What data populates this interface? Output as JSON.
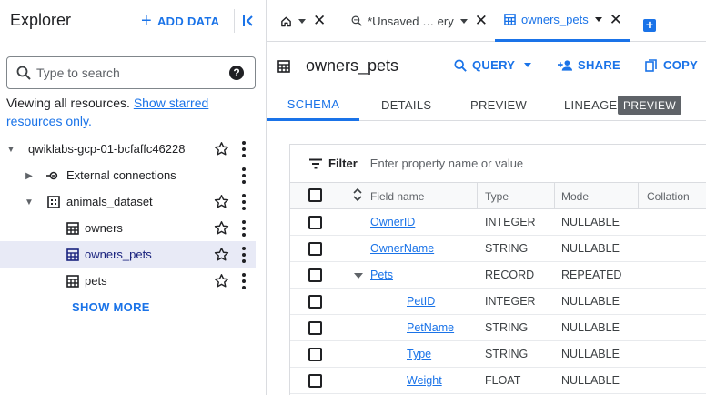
{
  "explorer": {
    "title": "Explorer",
    "add_data_label": "ADD DATA",
    "search_placeholder": "Type to search",
    "viewing_text": "Viewing all resources.",
    "show_starred_link": "Show starred resources only.",
    "tree": [
      {
        "label": "qwiklabs-gcp-01-bcfaffc46228",
        "level": 0,
        "icon": "none",
        "expanded": true,
        "starred": false
      },
      {
        "label": "External connections",
        "level": 1,
        "icon": "connection-icon",
        "expanded": false
      },
      {
        "label": "animals_dataset",
        "level": 1,
        "icon": "dataset-icon",
        "expanded": true
      },
      {
        "label": "owners",
        "level": 2,
        "icon": "table-icon"
      },
      {
        "label": "owners_pets",
        "level": 2,
        "icon": "table-icon",
        "selected": true
      },
      {
        "label": "pets",
        "level": 2,
        "icon": "table-icon"
      }
    ],
    "show_more_label": "SHOW MORE"
  },
  "tabs": {
    "items": [
      {
        "label": "",
        "icon": "home-icon"
      },
      {
        "label": "*Unsaved … ery",
        "icon": "query-icon"
      },
      {
        "label": "owners_pets",
        "icon": "table-icon",
        "active": true
      }
    ]
  },
  "table_header": {
    "name": "owners_pets",
    "query_label": "QUERY",
    "share_label": "SHARE",
    "copy_label": "COPY"
  },
  "subtabs": {
    "schema": "SCHEMA",
    "details": "DETAILS",
    "preview": "PREVIEW",
    "lineage": "LINEAGE",
    "lineage_badge": "PREVIEW"
  },
  "schema": {
    "filter_label": "Filter",
    "filter_placeholder": "Enter property name or value",
    "columns": {
      "field_name": "Field name",
      "type": "Type",
      "mode": "Mode",
      "collation": "Collation"
    },
    "rows": [
      {
        "name": "OwnerID",
        "type": "INTEGER",
        "mode": "NULLABLE",
        "indent": 0
      },
      {
        "name": "OwnerName",
        "type": "STRING",
        "mode": "NULLABLE",
        "indent": 0
      },
      {
        "name": "Pets",
        "type": "RECORD",
        "mode": "REPEATED",
        "indent": 0,
        "expandable": true
      },
      {
        "name": "PetID",
        "type": "INTEGER",
        "mode": "NULLABLE",
        "indent": 1
      },
      {
        "name": "PetName",
        "type": "STRING",
        "mode": "NULLABLE",
        "indent": 1
      },
      {
        "name": "Type",
        "type": "STRING",
        "mode": "NULLABLE",
        "indent": 1
      },
      {
        "name": "Weight",
        "type": "FLOAT",
        "mode": "NULLABLE",
        "indent": 1
      }
    ]
  },
  "colors": {
    "accent": "#1a73e8",
    "selected_bg": "#e8eaf6",
    "badge_bg": "#5f6368"
  }
}
